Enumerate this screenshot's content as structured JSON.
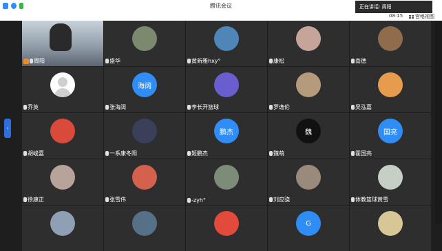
{
  "window": {
    "title": "腾讯会议"
  },
  "speaking_label": "正在讲话: 周阳",
  "time": "08:15",
  "layout_label": "宫格视图",
  "side_tab_icon": "chevron-left-icon",
  "participants": [
    {
      "name": "周阳",
      "avatar": "video",
      "color": "#6b7a86"
    },
    {
      "name": "盛华",
      "avatar": "photo",
      "color": "#7b8a6f"
    },
    {
      "name": "黄新雅hxy°",
      "avatar": "photo",
      "color": "#4f86b8"
    },
    {
      "name": "康松",
      "avatar": "photo",
      "color": "#c7a49a"
    },
    {
      "name": "南德",
      "avatar": "photo",
      "color": "#8f6c4c"
    },
    {
      "name": "乔英",
      "avatar": "default",
      "color": "#e3e3e3"
    },
    {
      "name": "张海阔",
      "avatar": "text",
      "label": "海阔",
      "color": "#2f8df5"
    },
    {
      "name": "李长开篮球",
      "avatar": "photo",
      "color": "#6a5dd0"
    },
    {
      "name": "罗逸伦",
      "avatar": "photo",
      "color": "#b59b7c"
    },
    {
      "name": "吴泓嘉",
      "avatar": "photo",
      "color": "#e79b4c"
    },
    {
      "name": "胡峻嘉",
      "avatar": "photo",
      "color": "#d94a3b"
    },
    {
      "name": "一系康冬阳",
      "avatar": "photo",
      "color": "#3a3f5a"
    },
    {
      "name": "姬鹏杰",
      "avatar": "text",
      "label": "鹏杰",
      "color": "#2f8df5"
    },
    {
      "name": "魏萌",
      "avatar": "text",
      "label": "魏",
      "color": "#111111"
    },
    {
      "name": "霍国亮",
      "avatar": "text",
      "label": "国亮",
      "color": "#2f8df5"
    },
    {
      "name": "徐康正",
      "avatar": "photo",
      "color": "#b8a39a"
    },
    {
      "name": "张雪伟",
      "avatar": "photo",
      "color": "#d4604e"
    },
    {
      "name": "-zyh°",
      "avatar": "photo",
      "color": "#7d8c78"
    },
    {
      "name": "刘应骁",
      "avatar": "photo",
      "color": "#9a8a7c"
    },
    {
      "name": "体教篮球黄雪",
      "avatar": "photo",
      "color": "#c6cfc6"
    },
    {
      "name": "",
      "avatar": "photo",
      "color": "#8fa0b5"
    },
    {
      "name": "",
      "avatar": "photo",
      "color": "#567088"
    },
    {
      "name": "",
      "avatar": "photo",
      "color": "#e24a3b"
    },
    {
      "name": "",
      "avatar": "text",
      "label": "G",
      "color": "#2f8df5"
    },
    {
      "name": "",
      "avatar": "photo",
      "color": "#d7c796"
    }
  ]
}
